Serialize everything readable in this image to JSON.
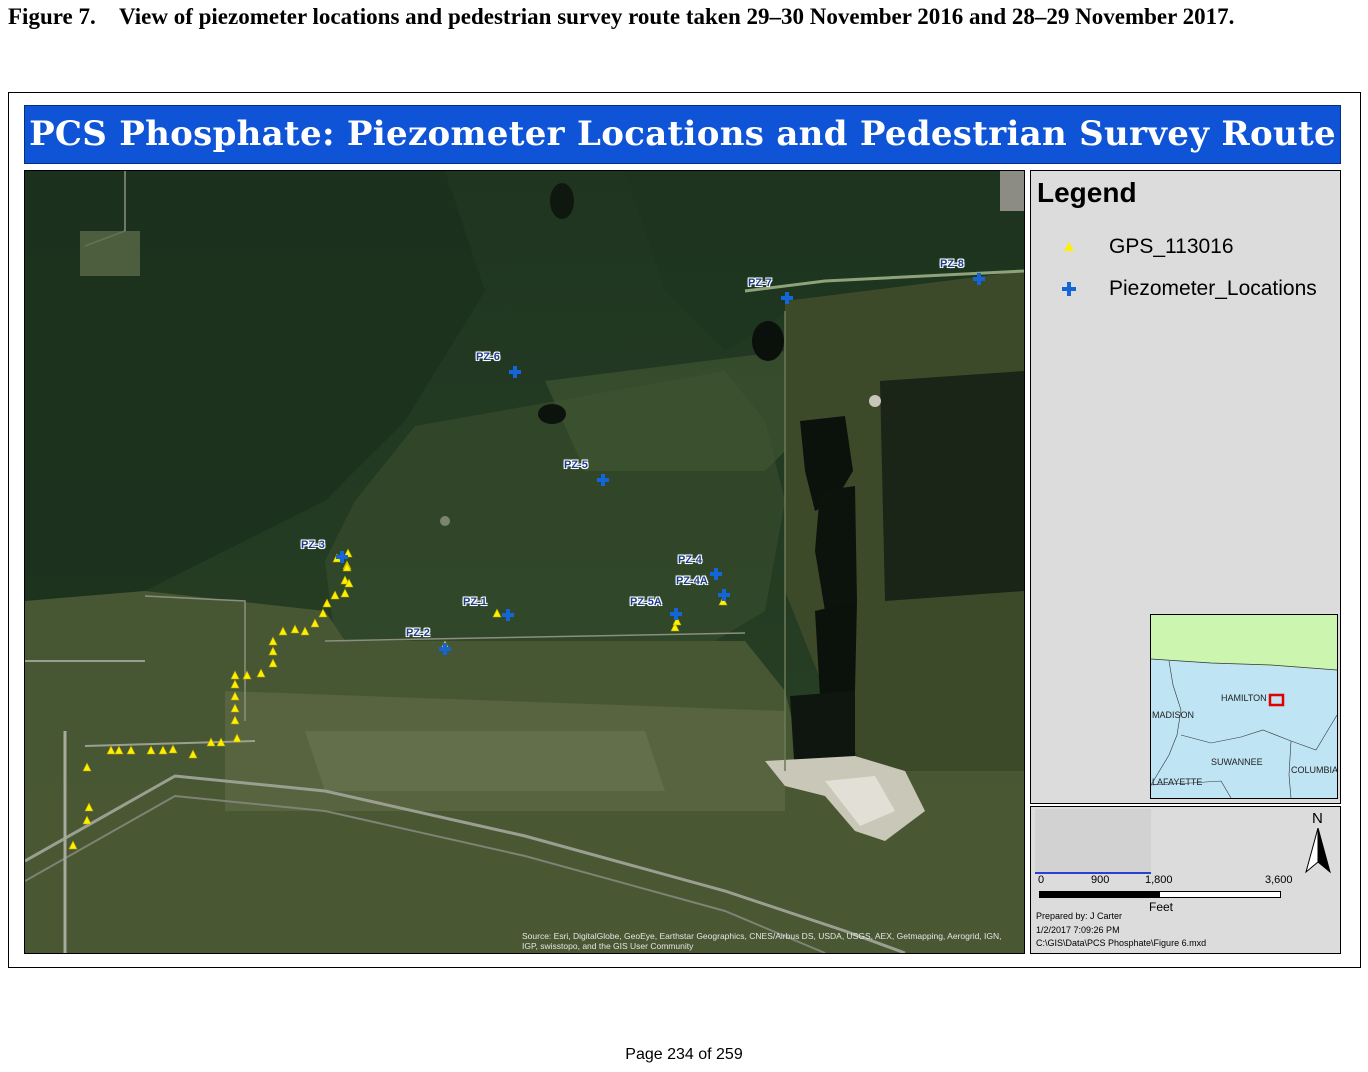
{
  "caption": {
    "number": "Figure 7.",
    "text": "View of piezometer locations and pedestrian survey route taken 29–30 November 2016 and 28–29 November 2017."
  },
  "map_title": "PCS Phosphate:  Piezometer Locations and Pedestrian Survey Route",
  "legend": {
    "title": "Legend",
    "items": [
      {
        "label": "GPS_113016",
        "symbol": "yellow-triangle-icon",
        "color": "#ffef00"
      },
      {
        "label": "Piezometer_Locations",
        "symbol": "blue-cross-icon",
        "color": "#1466d8"
      }
    ]
  },
  "piezometers": [
    {
      "label": "PZ-1"
    },
    {
      "label": "PZ-2"
    },
    {
      "label": "PZ-3"
    },
    {
      "label": "PZ-4"
    },
    {
      "label": "PZ-4A"
    },
    {
      "label": "PZ-5"
    },
    {
      "label": "PZ-5A"
    },
    {
      "label": "PZ-6"
    },
    {
      "label": "PZ-7"
    },
    {
      "label": "PZ-8"
    }
  ],
  "inset_map": {
    "counties": [
      "HAMILTON",
      "MADISON",
      "SUWANNEE",
      "COLUMBIA",
      "LAFAYETTE"
    ]
  },
  "scale_bar": {
    "ticks": [
      "0",
      "900",
      "1,800",
      "3,600"
    ],
    "unit": "Feet"
  },
  "north_arrow": "N",
  "metadata": {
    "prepared_by": "Prepared by: J Carter",
    "datetime": "1/2/2017 7:09:26 PM",
    "path": "C:\\GIS\\Data\\PCS Phosphate\\Figure 6.mxd"
  },
  "source_attribution": "Source: Esri, DigitalGlobe, GeoEye, Earthstar Geographics, CNES/Airbus DS, USDA, USGS, AEX, Getmapping, Aerogrid, IGN, IGP, swisstopo, and the GIS User Community",
  "colors": {
    "banner": "#0f54d6",
    "gps": "#ffef00",
    "piezometer": "#1466d8"
  },
  "page_footer": "Page 234 of 259"
}
